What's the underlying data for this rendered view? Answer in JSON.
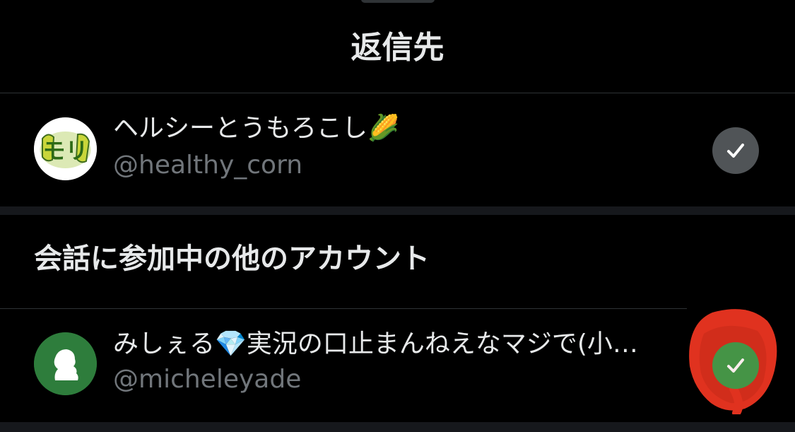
{
  "sheet": {
    "title": "返信先"
  },
  "primary_account": {
    "display_name": "ヘルシーとうもろこし",
    "emoji": "🌽",
    "handle": "@healthy_corn",
    "avatar_text": "モリ",
    "selected": true,
    "check_color": "#505457"
  },
  "others_section": {
    "heading": "会話に参加中の他のアカウント",
    "accounts": [
      {
        "display_name": "みしぇる💎実況の口止まんねえなマジで(小…",
        "handle": "@micheleyade",
        "selected": true,
        "check_color": "#3a9d4a",
        "annotation_color": "#e0321f"
      }
    ]
  },
  "colors": {
    "background": "#000000",
    "divider": "#2f3336",
    "section_gap": "#16181c",
    "primary_text": "#e7e9ea",
    "secondary_text": "#71767b"
  }
}
